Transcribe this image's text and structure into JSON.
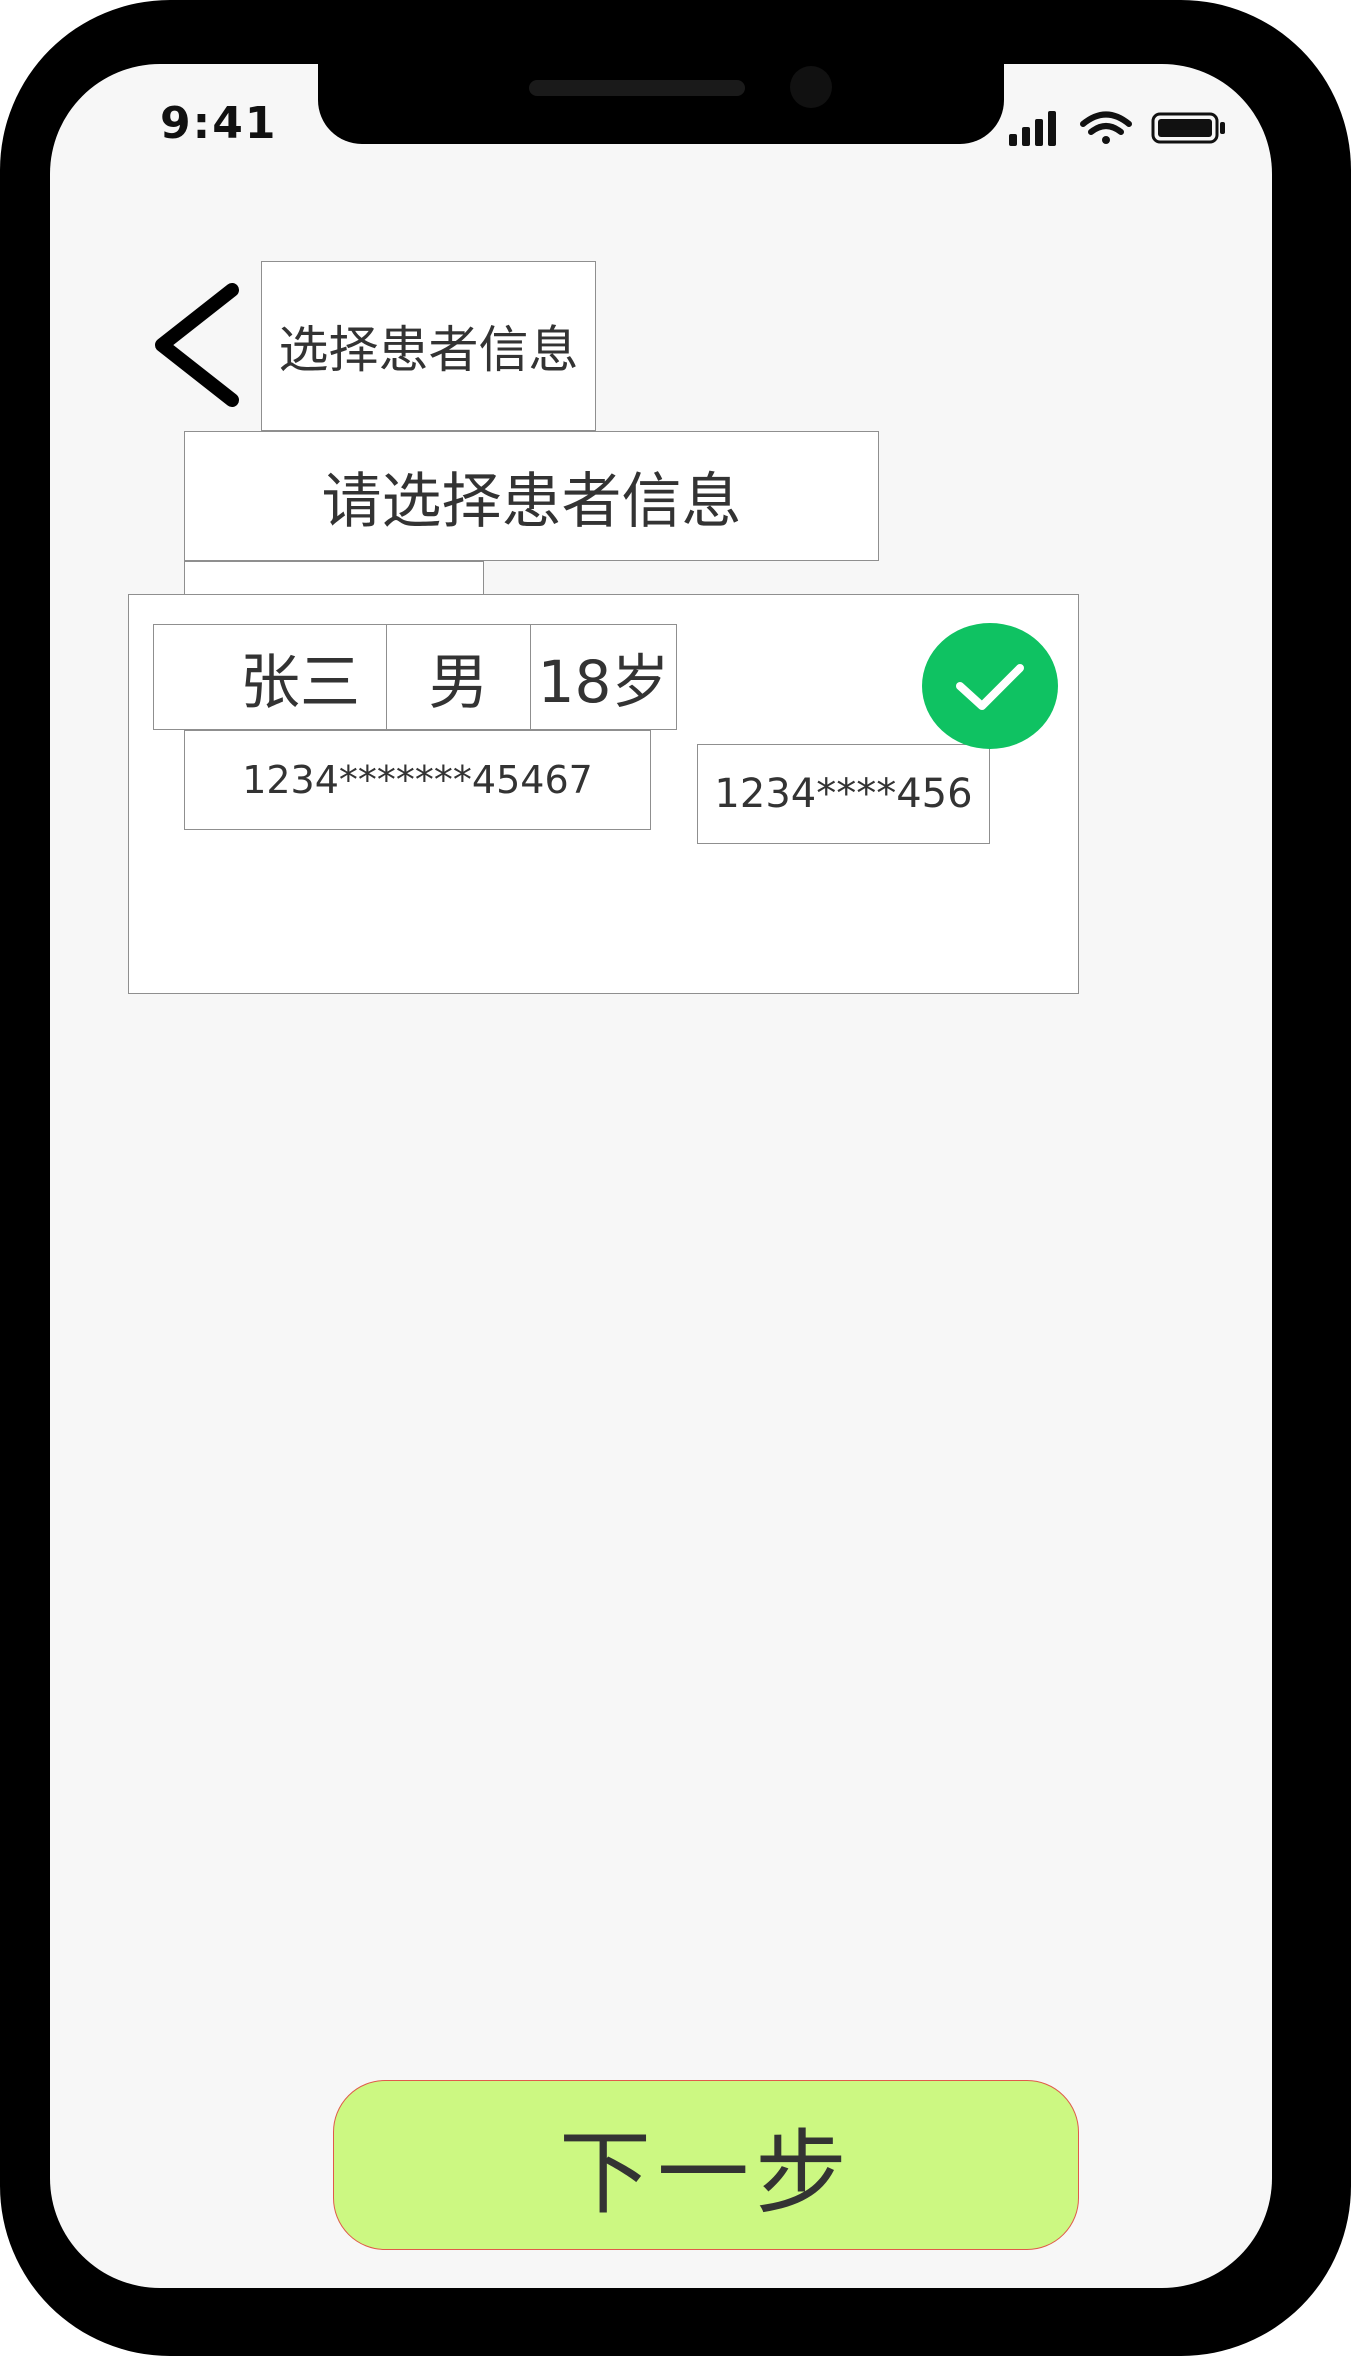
{
  "status_bar": {
    "time": "9:41",
    "signal_icon": "signal-bars-icon",
    "wifi_icon": "wifi-icon",
    "battery_icon": "battery-icon"
  },
  "header": {
    "back_icon": "chevron-left-icon",
    "title": "选择患者信息"
  },
  "main": {
    "prompt": "请选择患者信息",
    "patient_card": {
      "name": "张三",
      "gender": "男",
      "age": "18岁",
      "id_number": "1234*******45467",
      "phone": "1234****456",
      "selected": true,
      "selected_icon": "check-circle-icon",
      "selected_color": "#0fc262"
    }
  },
  "footer": {
    "next_label": "下一步",
    "next_color": "#ccf882"
  }
}
